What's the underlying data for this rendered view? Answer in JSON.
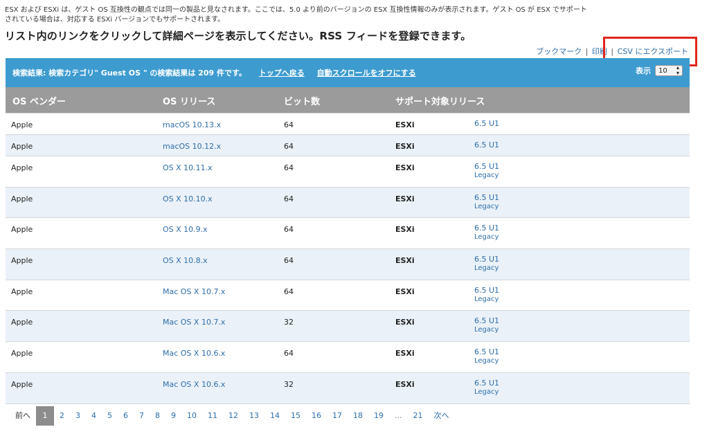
{
  "intro": {
    "line1": "ESX および ESXi は、ゲスト OS 互換性の観点では同一の製品と見なされます。ここでは、5.0 より前のバージョンの ESX 互換性情報のみが表示されます。ゲスト OS が ESX でサポート",
    "line2": "されている場合は、対応する ESXi バージョンでもサポートされます。",
    "headline": "リスト内のリンクをクリックして詳細ページを表示してください。RSS フィードを登録できます。"
  },
  "tools": {
    "bookmark": "ブックマーク",
    "sep1": "|",
    "print": "印刷",
    "sep2": "|",
    "export_csv": "CSV にエクスポート"
  },
  "result_bar": {
    "summary": "検索結果: 検索カテゴリ\" Guest OS \" の検索結果は 209 件です。",
    "back_to_top": "トップへ戻る",
    "autoscroll_off": "自動スクロールをオフにする",
    "show_label": "表示",
    "page_size": "10",
    "colors": {
      "bar": "#3d9bd0",
      "header": "#9b9b9b",
      "highlight": "#e0261d"
    }
  },
  "table": {
    "headers": [
      "OS ベンダー",
      "OS リリース",
      "ビット数",
      "サポート対象リリース"
    ],
    "rows": [
      {
        "vendor": "Apple",
        "os": "macOS 10.13.x",
        "bits": "64",
        "product": "ESXi",
        "release": "6.5 U1",
        "note": ""
      },
      {
        "vendor": "Apple",
        "os": "macOS 10.12.x",
        "bits": "64",
        "product": "ESXi",
        "release": "6.5 U1",
        "note": ""
      },
      {
        "vendor": "Apple",
        "os": "OS X 10.11.x",
        "bits": "64",
        "product": "ESXi",
        "release": "6.5 U1",
        "note": "Legacy"
      },
      {
        "vendor": "Apple",
        "os": "OS X 10.10.x",
        "bits": "64",
        "product": "ESXi",
        "release": "6.5 U1",
        "note": "Legacy"
      },
      {
        "vendor": "Apple",
        "os": "OS X 10.9.x",
        "bits": "64",
        "product": "ESXi",
        "release": "6.5 U1",
        "note": "Legacy"
      },
      {
        "vendor": "Apple",
        "os": "OS X 10.8.x",
        "bits": "64",
        "product": "ESXi",
        "release": "6.5 U1",
        "note": "Legacy"
      },
      {
        "vendor": "Apple",
        "os": "Mac OS X 10.7.x",
        "bits": "64",
        "product": "ESXi",
        "release": "6.5 U1",
        "note": "Legacy"
      },
      {
        "vendor": "Apple",
        "os": "Mac OS X 10.7.x",
        "bits": "32",
        "product": "ESXi",
        "release": "6.5 U1",
        "note": "Legacy"
      },
      {
        "vendor": "Apple",
        "os": "Mac OS X 10.6.x",
        "bits": "64",
        "product": "ESXi",
        "release": "6.5 U1",
        "note": "Legacy"
      },
      {
        "vendor": "Apple",
        "os": "Mac OS X 10.6.x",
        "bits": "32",
        "product": "ESXi",
        "release": "6.5 U1",
        "note": "Legacy"
      }
    ]
  },
  "pager": {
    "prev": "前へ",
    "pages": [
      "1",
      "2",
      "3",
      "4",
      "5",
      "6",
      "7",
      "8",
      "9",
      "10",
      "11",
      "12",
      "13",
      "14",
      "15",
      "16",
      "17",
      "18",
      "19",
      "...",
      "21"
    ],
    "current": "1",
    "next": "次へ"
  }
}
